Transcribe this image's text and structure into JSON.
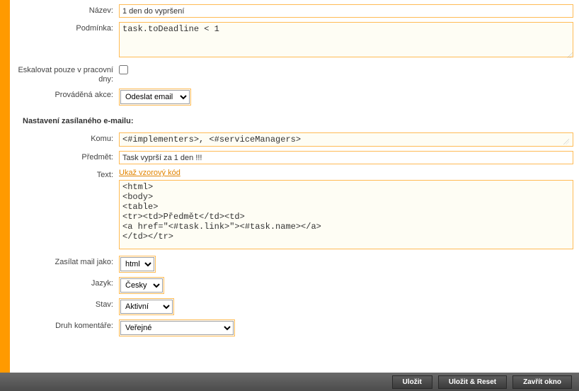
{
  "form": {
    "name": {
      "label": "Název:",
      "value": "1 den do vypršení"
    },
    "condition": {
      "label": "Podmínka:",
      "value": "task.toDeadline < 1"
    },
    "workdaysOnly": {
      "label": "Eskalovat pouze v pracovní dny:",
      "checked": false
    },
    "action": {
      "label": "Prováděná akce:",
      "selected": "Odeslat email"
    },
    "sectionEmail": "Nastavení zasílaného e-mailu:",
    "to": {
      "label": "Komu:",
      "value": "<#implementers>, <#serviceManagers>"
    },
    "subject": {
      "label": "Předmět:",
      "value": "Task vyprší za 1 den !!!"
    },
    "text": {
      "label": "Text:",
      "link": "Ukaž vzorový kód",
      "value": "<html>\n<body>\n<table>\n<tr><td>Předmět</td><td>\n<a href=\"<#task.link>\"><#task.name></a>\n</td></tr>"
    },
    "mailAs": {
      "label": "Zasílat mail jako:",
      "selected": "html"
    },
    "language": {
      "label": "Jazyk:",
      "selected": "Česky"
    },
    "state": {
      "label": "Stav:",
      "selected": "Aktivní"
    },
    "commentKind": {
      "label": "Druh komentáře:",
      "selected": "Veřejné"
    }
  },
  "footer": {
    "save": "Uložit",
    "saveReset": "Uložit & Reset",
    "close": "Zavřít okno"
  }
}
